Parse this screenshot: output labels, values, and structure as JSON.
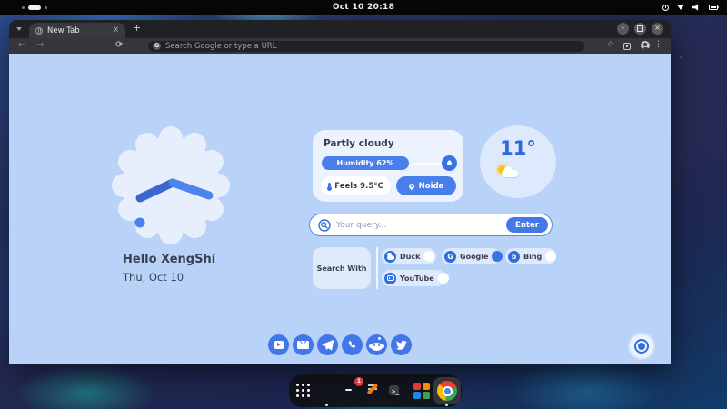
{
  "topbar": {
    "clock": "Oct 10 20:18"
  },
  "browser": {
    "tab_title": "New Tab",
    "address_placeholder": "Search Google or type a URL"
  },
  "icons": {
    "close": "×",
    "plus": "+",
    "minimize": "–",
    "back": "←",
    "forward": "→",
    "reload": "⟳",
    "star": "☆",
    "menu": "⋮",
    "g_badge": "G",
    "google_g": "G",
    "bing_b": "b"
  },
  "newtab": {
    "greeting": "Hello XengShi",
    "date": "Thu, Oct 10",
    "weather": {
      "condition": "Partly cloudy",
      "humidity": "Humidity 62%",
      "feels": "Feels 9.5°C",
      "location": "Noida",
      "temperature": "11°"
    },
    "search": {
      "placeholder": "Your query...",
      "enter": "Enter"
    },
    "search_with": {
      "label": "Search With",
      "engines": [
        {
          "name": "Duck",
          "selected": false
        },
        {
          "name": "Google",
          "selected": true
        },
        {
          "name": "Bing",
          "selected": false
        },
        {
          "name": "YouTube",
          "selected": false
        }
      ]
    },
    "socials": [
      "youtube",
      "mail",
      "telegram",
      "whatsapp",
      "reddit",
      "twitter"
    ]
  },
  "dock": {
    "badge": "1",
    "items": [
      "show-apps",
      "firefox",
      "package-manager",
      "text-editor",
      "terminal",
      "app-store",
      "chrome"
    ]
  },
  "colors": {
    "accent": "#4478e8",
    "page_background": "#b9d2f8",
    "card_background": "#ecf2fe"
  }
}
